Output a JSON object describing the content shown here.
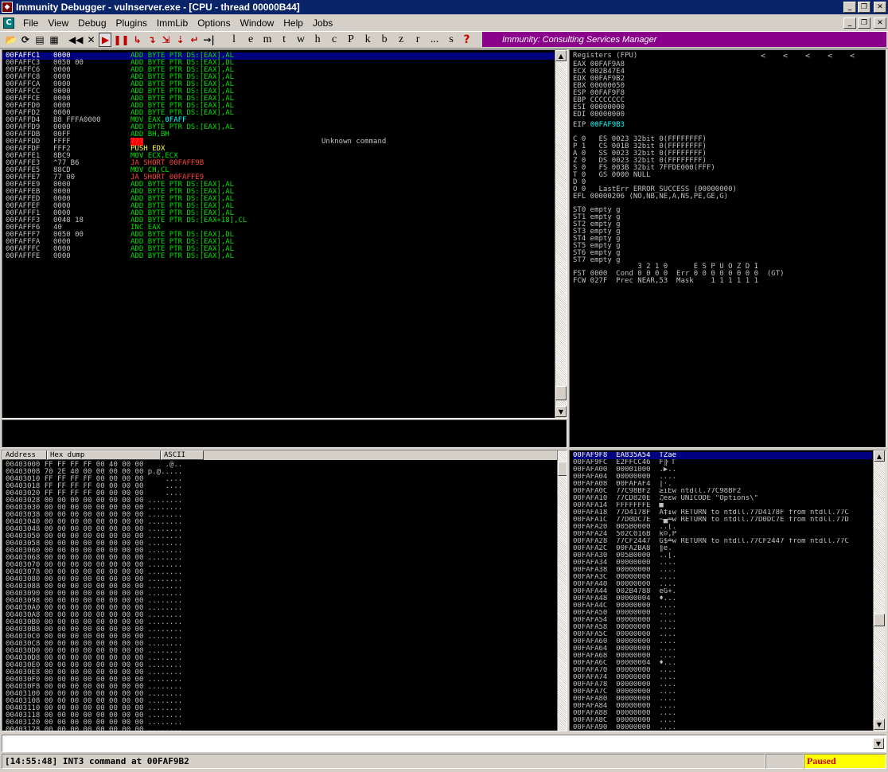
{
  "window": {
    "title": "Immunity Debugger - vulnserver.exe - [CPU - thread 00000B44]",
    "icon": "immunity-logo-icon"
  },
  "menu": {
    "items": [
      "File",
      "View",
      "Debug",
      "Plugins",
      "ImmLib",
      "Options",
      "Window",
      "Help",
      "Jobs"
    ]
  },
  "toolbar": {
    "icons": [
      "open-icon",
      "run-to-icon",
      "layout-icon",
      "grid-icon",
      "rewind-icon",
      "close-icon",
      "play-icon",
      "pause-icon",
      "step-into-icon",
      "step-over-icon",
      "trace-into-icon",
      "trace-over-icon",
      "execute-till-return-icon",
      "go-to-icon"
    ],
    "letters": [
      "l",
      "e",
      "m",
      "t",
      "w",
      "h",
      "c",
      "P",
      "k",
      "b",
      "z",
      "r",
      "...",
      "s",
      "?"
    ],
    "banner": "Immunity: Consulting Services Manager"
  },
  "cpu": {
    "rows": [
      {
        "addr": "00FAFFC1",
        "hex": "0000",
        "op": "ADD",
        "args": "BYTE PTR DS:[EAX],AL",
        "opc": "add",
        "sel": true
      },
      {
        "addr": "00FAFFC3",
        "hex": "0050 00",
        "op": "ADD",
        "args": "BYTE PTR DS:[EAX],DL",
        "opc": "add"
      },
      {
        "addr": "00FAFFC6",
        "hex": "0000",
        "op": "ADD",
        "args": "BYTE PTR DS:[EAX],AL",
        "opc": "add"
      },
      {
        "addr": "00FAFFC8",
        "hex": "0000",
        "op": "ADD",
        "args": "BYTE PTR DS:[EAX],AL",
        "opc": "add"
      },
      {
        "addr": "00FAFFCA",
        "hex": "0000",
        "op": "ADD",
        "args": "BYTE PTR DS:[EAX],AL",
        "opc": "add"
      },
      {
        "addr": "00FAFFCC",
        "hex": "0000",
        "op": "ADD",
        "args": "BYTE PTR DS:[EAX],AL",
        "opc": "add"
      },
      {
        "addr": "00FAFFCE",
        "hex": "0000",
        "op": "ADD",
        "args": "BYTE PTR DS:[EAX],AL",
        "opc": "add"
      },
      {
        "addr": "00FAFFD0",
        "hex": "0000",
        "op": "ADD",
        "args": "BYTE PTR DS:[EAX],AL",
        "opc": "add"
      },
      {
        "addr": "00FAFFD2",
        "hex": "0000",
        "op": "ADD",
        "args": "BYTE PTR DS:[EAX],AL",
        "opc": "add"
      },
      {
        "addr": "00FAFFD4",
        "hex": "B8 FFFA0000",
        "op": "MOV",
        "args": "EAX,",
        "extra": "0FAFF",
        "opc": "mov"
      },
      {
        "addr": "00FAFFD9",
        "hex": "0000",
        "op": "ADD",
        "args": "BYTE PTR DS:[EAX],AL",
        "opc": "add"
      },
      {
        "addr": "00FAFFDB",
        "hex": "00FF",
        "op": "ADD",
        "args": "BH,BH",
        "opc": "add"
      },
      {
        "addr": "00FAFFDD",
        "hex": "FFFF",
        "op": "???",
        "args": "",
        "opc": "bad",
        "comment": "Unknown command"
      },
      {
        "addr": "00FAFFDF",
        "hex": "FFF2",
        "op": "PUSH",
        "args": "EDX",
        "opc": "push"
      },
      {
        "addr": "00FAFFE1",
        "hex": "8BC9",
        "op": "MOV",
        "args": "ECX,ECX",
        "opc": "mov"
      },
      {
        "addr": "00FAFFE3",
        "hex": "^77 B6",
        "op": "JA",
        "args": "SHORT 00FAFF9B",
        "opc": "jmp"
      },
      {
        "addr": "00FAFFE5",
        "hex": "88CD",
        "op": "MOV",
        "args": "CH,CL",
        "opc": "mov"
      },
      {
        "addr": "00FAFFE7",
        "hex": "77 00",
        "op": "JA",
        "args": "SHORT 00FAFFE9",
        "opc": "jmp"
      },
      {
        "addr": "00FAFFE9",
        "hex": "0000",
        "op": "ADD",
        "args": "BYTE PTR DS:[EAX],AL",
        "opc": "add"
      },
      {
        "addr": "00FAFFEB",
        "hex": "0000",
        "op": "ADD",
        "args": "BYTE PTR DS:[EAX],AL",
        "opc": "add"
      },
      {
        "addr": "00FAFFED",
        "hex": "0000",
        "op": "ADD",
        "args": "BYTE PTR DS:[EAX],AL",
        "opc": "add"
      },
      {
        "addr": "00FAFFEF",
        "hex": "0000",
        "op": "ADD",
        "args": "BYTE PTR DS:[EAX],AL",
        "opc": "add"
      },
      {
        "addr": "00FAFFF1",
        "hex": "0000",
        "op": "ADD",
        "args": "BYTE PTR DS:[EAX],AL",
        "opc": "add"
      },
      {
        "addr": "00FAFFF3",
        "hex": "0048 18",
        "op": "ADD",
        "args": "BYTE PTR DS:[EAX+18],CL",
        "opc": "add"
      },
      {
        "addr": "00FAFFF6",
        "hex": "40",
        "op": "INC",
        "args": "EAX",
        "opc": "add"
      },
      {
        "addr": "00FAFFF7",
        "hex": "0050 00",
        "op": "ADD",
        "args": "BYTE PTR DS:[EAX],DL",
        "opc": "add"
      },
      {
        "addr": "00FAFFFA",
        "hex": "0000",
        "op": "ADD",
        "args": "BYTE PTR DS:[EAX],AL",
        "opc": "add"
      },
      {
        "addr": "00FAFFFC",
        "hex": "0000",
        "op": "ADD",
        "args": "BYTE PTR DS:[EAX],AL",
        "opc": "add"
      },
      {
        "addr": "00FAFFFE",
        "hex": "0000",
        "op": "ADD",
        "args": "BYTE PTR DS:[EAX],AL",
        "opc": "add"
      }
    ]
  },
  "registers": {
    "title": "Registers (FPU)",
    "nav": [
      "<",
      "<",
      "<",
      "<",
      "<"
    ],
    "gp": [
      "EAX 00FAF9A8",
      "ECX 002B47E4",
      "EDX 00FAF9B2",
      "EBX 00000050",
      "ESP 00FAF9F8",
      "EBP CCCCCCCC",
      "ESI 00000000",
      "EDI 00000000"
    ],
    "eip_label": "EIP",
    "eip_value": "00FAF9B3",
    "flags": [
      "C 0   ES 0023 32bit 0(FFFFFFFF)",
      "P 1   CS 001B 32bit 0(FFFFFFFF)",
      "A 0   SS 0023 32bit 0(FFFFFFFF)",
      "Z 0   DS 0023 32bit 0(FFFFFFFF)",
      "S 0   FS 003B 32bit 7FFDE000(FFF)",
      "T 0   GS 0000 NULL",
      "D 0",
      "O 0   LastErr ERROR_SUCCESS (00000000)"
    ],
    "efl": "EFL 00000206 (NO,NB,NE,A,NS,PE,GE,G)",
    "st": [
      "ST0 empty g",
      "ST1 empty g",
      "ST2 empty g",
      "ST3 empty g",
      "ST4 empty g",
      "ST5 empty g",
      "ST6 empty g",
      "ST7 empty g"
    ],
    "fpu": [
      "               3 2 1 0      E S P U O Z D I",
      "FST 0000  Cond 0 0 0 0  Err 0 0 0 0 0 0 0 0  (GT)",
      "FCW 027F  Prec NEAR,53  Mask    1 1 1 1 1 1"
    ]
  },
  "dump": {
    "headers": [
      "Address",
      "Hex dump",
      "ASCII"
    ],
    "rows": [
      "00403000 FF FF FF FF 00 40 00 00     .@..",
      "00403008 70 2E 40 00 00 00 00 00 p.@.....",
      "00403010 FF FF FF FF 00 00 00 00     ....",
      "00403018 FF FF FF FF 00 00 00 00     ....",
      "00403020 FF FF FF FF 00 00 00 00     ....",
      "00403028 00 00 00 00 00 00 00 00 ........",
      "00403030 00 00 00 00 00 00 00 00 ........",
      "00403038 00 00 00 00 00 00 00 00 ........",
      "00403040 00 00 00 00 00 00 00 00 ........",
      "00403048 00 00 00 00 00 00 00 00 ........",
      "00403050 00 00 00 00 00 00 00 00 ........",
      "00403058 00 00 00 00 00 00 00 00 ........",
      "00403060 00 00 00 00 00 00 00 00 ........",
      "00403068 00 00 00 00 00 00 00 00 ........",
      "00403070 00 00 00 00 00 00 00 00 ........",
      "00403078 00 00 00 00 00 00 00 00 ........",
      "00403080 00 00 00 00 00 00 00 00 ........",
      "00403088 00 00 00 00 00 00 00 00 ........",
      "00403090 00 00 00 00 00 00 00 00 ........",
      "00403098 00 00 00 00 00 00 00 00 ........",
      "004030A0 00 00 00 00 00 00 00 00 ........",
      "004030A8 00 00 00 00 00 00 00 00 ........",
      "004030B0 00 00 00 00 00 00 00 00 ........",
      "004030B8 00 00 00 00 00 00 00 00 ........",
      "004030C0 00 00 00 00 00 00 00 00 ........",
      "004030C8 00 00 00 00 00 00 00 00 ........",
      "004030D0 00 00 00 00 00 00 00 00 ........",
      "004030D8 00 00 00 00 00 00 00 00 ........",
      "004030E0 00 00 00 00 00 00 00 00 ........",
      "004030E8 00 00 00 00 00 00 00 00 ........",
      "004030F0 00 00 00 00 00 00 00 00 ........",
      "004030F8 00 00 00 00 00 00 00 00 ........",
      "00403100 00 00 00 00 00 00 00 00 ........",
      "00403108 00 00 00 00 00 00 00 00 ........",
      "00403110 00 00 00 00 00 00 00 00 ........",
      "00403118 00 00 00 00 00 00 00 00 ........",
      "00403120 00 00 00 00 00 00 00 00 ........",
      "00403128 00 00 00 00 00 00 00 00 ........"
    ]
  },
  "stack": {
    "rows": [
      "00FAF9F8  EA835A54  TZâê",
      "00FAF9FC  E2FFCC46  F╠ Γ",
      "00FAFA00  00001000  .▶..",
      "00FAFA04  00000000  ....",
      "00FAFA08  00FAFAF4  ⌠·.",
      "00FAFA0C  77C98BF2  ≥ïÉw ntdll.77C98BF2",
      "00FAFA10  77CD820E  ♫éεw UNICODE \"Options\\\"",
      "00FAFA14  FFFFFFFE  ■",
      "00FAFA18  77D4178F  Å‡↨w RETURN to ntdll.77D4178F from ntdll.77C",
      "00FAFA1C  77D0DC7E  ~▄═w RETURN to ntdll.77D0DC7E from ntdll.77D",
      "00FAFA20  005B0000  ..[.",
      "00FAFA24  502C016B  k☺,P",
      "00FAFA28  77CF2447  G$╧w RETURN to ntdll.77CF2447 from ntdll.77C",
      "00FAFA2C  00FA2BA8  ║ê.",
      "00FAFA30  005B0000  ..[.",
      "00FAFA34  00000000  ....",
      "00FAFA38  00000000  ....",
      "00FAFA3C  00000000  ....",
      "00FAFA40  00000000  ....",
      "00FAFA44  002B4788  êG+.",
      "00FAFA48  00000004  ♦...",
      "00FAFA4C  00000000  ....",
      "00FAFA50  00000000  ....",
      "00FAFA54  00000000  ....",
      "00FAFA58  00000000  ....",
      "00FAFA5C  00000000  ....",
      "00FAFA60  00000000  ....",
      "00FAFA64  00000000  ....",
      "00FAFA68  00000000  ....",
      "00FAFA6C  00000004  ♦...",
      "00FAFA70  00000000  ....",
      "00FAFA74  00000000  ....",
      "00FAFA78  00000000  ....",
      "00FAFA7C  00000000  ....",
      "00FAFA80  00000000  ....",
      "00FAFA84  00000000  ....",
      "00FAFA88  00000000  ....",
      "00FAFA8C  00000000  ....",
      "00FAFA90  00000000  ...."
    ]
  },
  "status": {
    "message": "[14:55:48] INT3 command at 00FAF9B2",
    "state": "Paused"
  },
  "colors": {
    "add": "#00e000",
    "mov": "#00e000",
    "push": "#ffff40",
    "jmp": "#ff4040",
    "bad_bg": "#ff0000",
    "extra": "#00ffff",
    "reg_highlight": "#00ffff"
  }
}
